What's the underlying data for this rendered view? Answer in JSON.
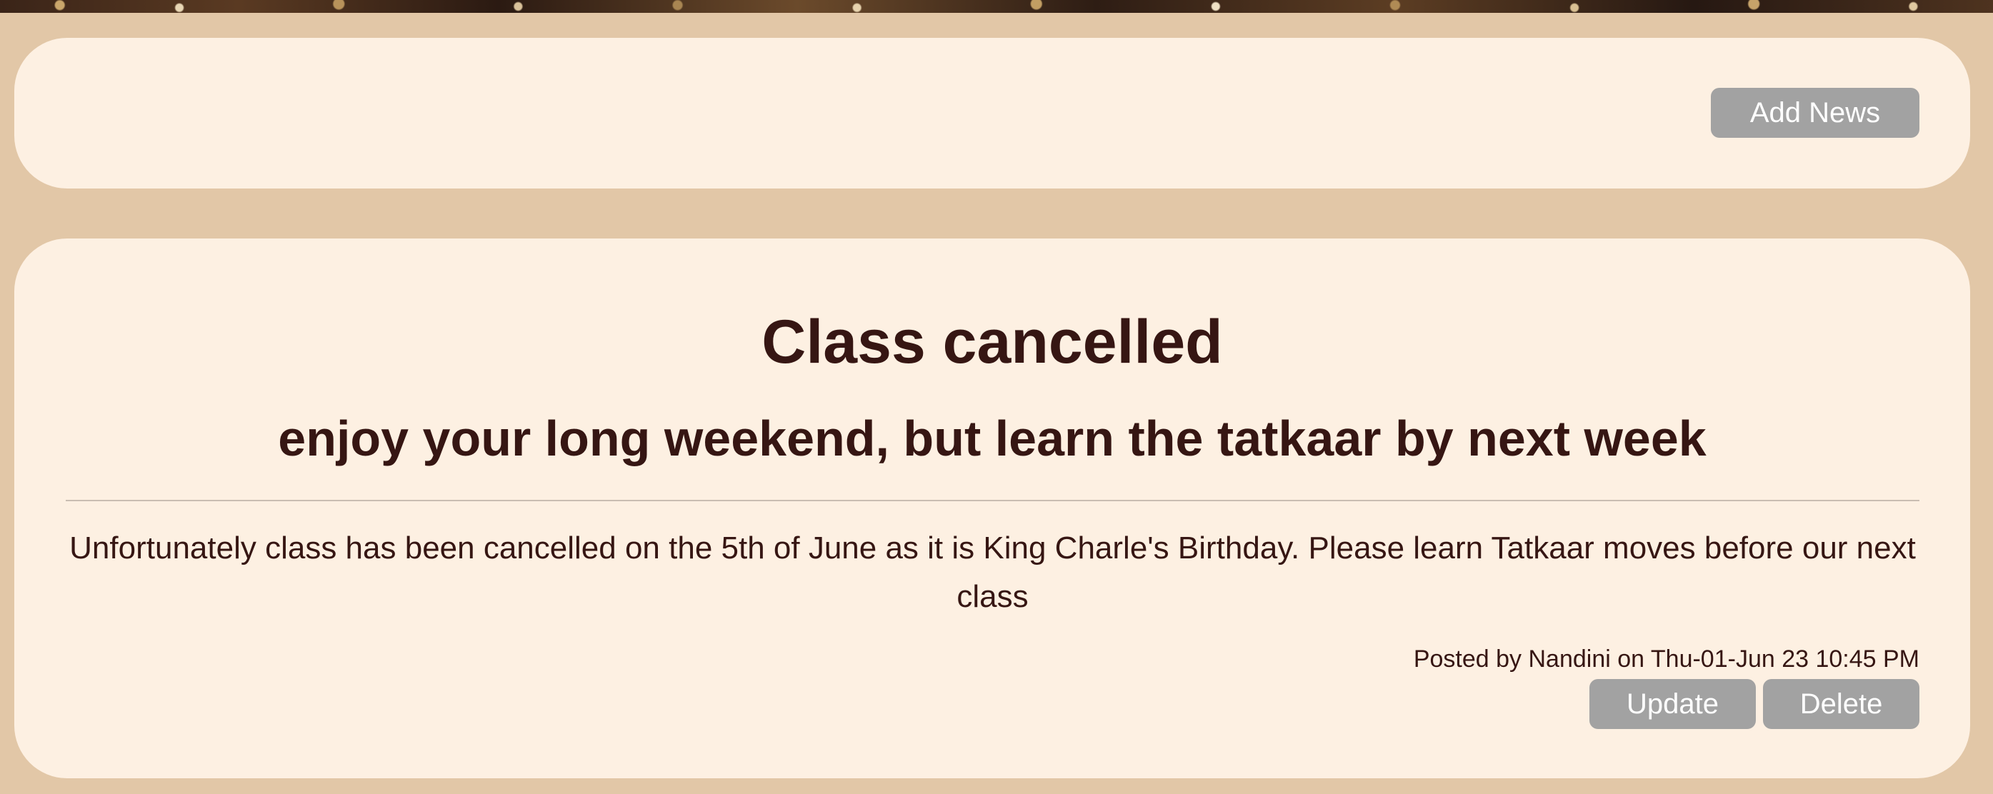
{
  "toolbar": {
    "add_news_label": "Add News"
  },
  "news": [
    {
      "title": "Class cancelled",
      "subtitle": "enjoy your long weekend, but learn the tatkaar by next week",
      "body": "Unfortunately class has been cancelled on the 5th of June as it is King Charle's Birthday. Please learn Tatkaar moves before our next class",
      "meta": "Posted by Nandini on Thu-01-Jun 23 10:45 PM",
      "update_label": "Update",
      "delete_label": "Delete"
    }
  ],
  "colors": {
    "page_background": "#e2c7a7",
    "card_background": "#fdf0e2",
    "text": "#361613",
    "button_background": "#a2a2a2",
    "button_text": "#ffffff"
  }
}
